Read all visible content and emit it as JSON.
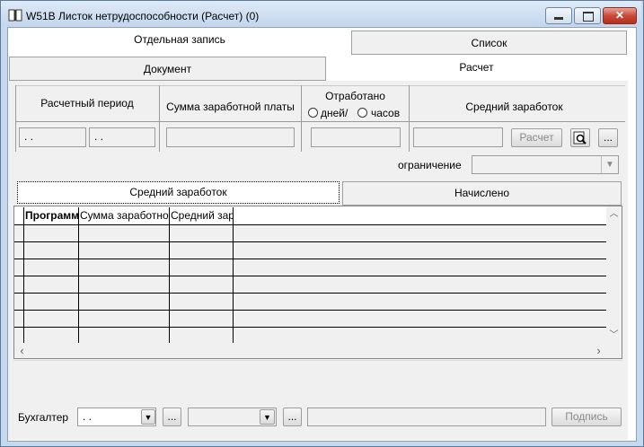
{
  "window": {
    "title": "W51B Листок нетрудоспособности (Расчет) (0)",
    "min_glyph": "▬",
    "max_glyph": "▭",
    "close_glyph": "✕"
  },
  "tabs": {
    "single": "Отдельная запись",
    "list": "Список",
    "document": "Документ",
    "calc": "Расчет"
  },
  "header": {
    "period_label": "Расчетный период",
    "salary_sum_label": "Сумма заработной платы",
    "worked_label": "Отработано",
    "days_label": "дней/",
    "hours_label": "часов",
    "avg_label": "Средний заработок"
  },
  "inputs": {
    "period_from": " .  .",
    "period_to": " .  .",
    "salary_sum": "",
    "worked": "",
    "avg": "",
    "calc_button": "Расчет",
    "more_button": "...",
    "limit_label": "ограничение",
    "limit_value": ""
  },
  "subtabs": {
    "avg": "Средний заработок",
    "accrued": "Начислено"
  },
  "grid": {
    "columns": [
      "Программа",
      "Сумма заработной платы",
      "Средний заработок"
    ],
    "rows": 7
  },
  "footer": {
    "accountant_label": "Бухгалтер",
    "accountant_value": " .  .",
    "more1": "...",
    "second_value": "",
    "more2": "...",
    "comment": "",
    "sign_button": "Подпись"
  },
  "colors": {
    "titlebar": "#c6d9ee",
    "panel": "#f0f0f0",
    "close": "#c8493a"
  }
}
